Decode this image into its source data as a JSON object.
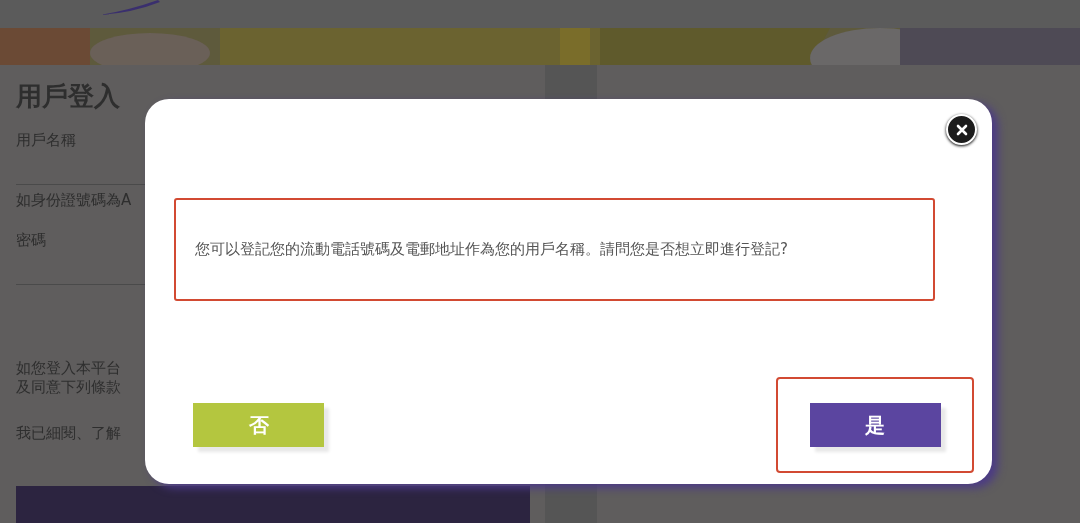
{
  "login": {
    "title": "用戶登入",
    "username_label": "用戶名稱",
    "id_hint": "如身份證號碼為A",
    "password_label": "密碼",
    "terms_line_1": "如您登入本平台",
    "terms_line_2": "及同意下列條款",
    "agree_text": "我已細閱、了解"
  },
  "dialog": {
    "message": "您可以登記您的流動電話號碼及電郵地址作為您的用戶名稱。請問您是否想立即進行登記?",
    "message_highlighted": true,
    "buttons": [
      {
        "label": "否",
        "kind": "secondary",
        "highlighted": false
      },
      {
        "label": "是",
        "kind": "primary",
        "highlighted": true
      }
    ]
  }
}
